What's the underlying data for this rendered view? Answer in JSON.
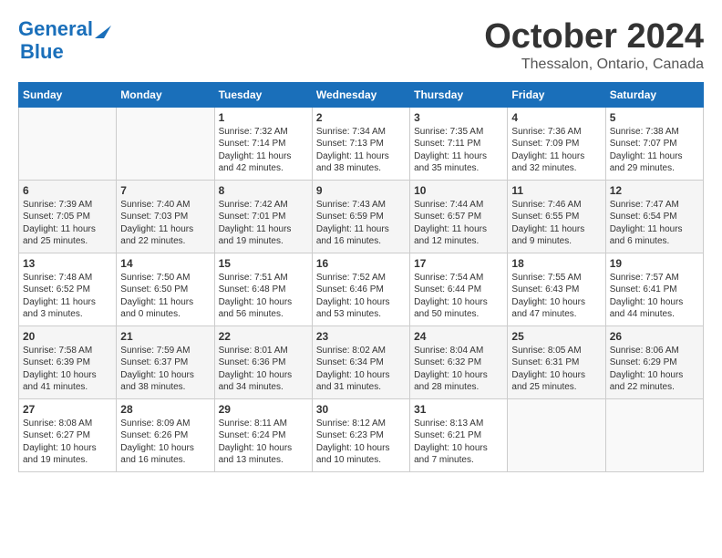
{
  "header": {
    "logo_line1": "General",
    "logo_line2": "Blue",
    "month_title": "October 2024",
    "location": "Thessalon, Ontario, Canada"
  },
  "weekdays": [
    "Sunday",
    "Monday",
    "Tuesday",
    "Wednesday",
    "Thursday",
    "Friday",
    "Saturday"
  ],
  "weeks": [
    [
      {
        "day": "",
        "info": ""
      },
      {
        "day": "",
        "info": ""
      },
      {
        "day": "1",
        "info": "Sunrise: 7:32 AM\nSunset: 7:14 PM\nDaylight: 11 hours and 42 minutes."
      },
      {
        "day": "2",
        "info": "Sunrise: 7:34 AM\nSunset: 7:13 PM\nDaylight: 11 hours and 38 minutes."
      },
      {
        "day": "3",
        "info": "Sunrise: 7:35 AM\nSunset: 7:11 PM\nDaylight: 11 hours and 35 minutes."
      },
      {
        "day": "4",
        "info": "Sunrise: 7:36 AM\nSunset: 7:09 PM\nDaylight: 11 hours and 32 minutes."
      },
      {
        "day": "5",
        "info": "Sunrise: 7:38 AM\nSunset: 7:07 PM\nDaylight: 11 hours and 29 minutes."
      }
    ],
    [
      {
        "day": "6",
        "info": "Sunrise: 7:39 AM\nSunset: 7:05 PM\nDaylight: 11 hours and 25 minutes."
      },
      {
        "day": "7",
        "info": "Sunrise: 7:40 AM\nSunset: 7:03 PM\nDaylight: 11 hours and 22 minutes."
      },
      {
        "day": "8",
        "info": "Sunrise: 7:42 AM\nSunset: 7:01 PM\nDaylight: 11 hours and 19 minutes."
      },
      {
        "day": "9",
        "info": "Sunrise: 7:43 AM\nSunset: 6:59 PM\nDaylight: 11 hours and 16 minutes."
      },
      {
        "day": "10",
        "info": "Sunrise: 7:44 AM\nSunset: 6:57 PM\nDaylight: 11 hours and 12 minutes."
      },
      {
        "day": "11",
        "info": "Sunrise: 7:46 AM\nSunset: 6:55 PM\nDaylight: 11 hours and 9 minutes."
      },
      {
        "day": "12",
        "info": "Sunrise: 7:47 AM\nSunset: 6:54 PM\nDaylight: 11 hours and 6 minutes."
      }
    ],
    [
      {
        "day": "13",
        "info": "Sunrise: 7:48 AM\nSunset: 6:52 PM\nDaylight: 11 hours and 3 minutes."
      },
      {
        "day": "14",
        "info": "Sunrise: 7:50 AM\nSunset: 6:50 PM\nDaylight: 11 hours and 0 minutes."
      },
      {
        "day": "15",
        "info": "Sunrise: 7:51 AM\nSunset: 6:48 PM\nDaylight: 10 hours and 56 minutes."
      },
      {
        "day": "16",
        "info": "Sunrise: 7:52 AM\nSunset: 6:46 PM\nDaylight: 10 hours and 53 minutes."
      },
      {
        "day": "17",
        "info": "Sunrise: 7:54 AM\nSunset: 6:44 PM\nDaylight: 10 hours and 50 minutes."
      },
      {
        "day": "18",
        "info": "Sunrise: 7:55 AM\nSunset: 6:43 PM\nDaylight: 10 hours and 47 minutes."
      },
      {
        "day": "19",
        "info": "Sunrise: 7:57 AM\nSunset: 6:41 PM\nDaylight: 10 hours and 44 minutes."
      }
    ],
    [
      {
        "day": "20",
        "info": "Sunrise: 7:58 AM\nSunset: 6:39 PM\nDaylight: 10 hours and 41 minutes."
      },
      {
        "day": "21",
        "info": "Sunrise: 7:59 AM\nSunset: 6:37 PM\nDaylight: 10 hours and 38 minutes."
      },
      {
        "day": "22",
        "info": "Sunrise: 8:01 AM\nSunset: 6:36 PM\nDaylight: 10 hours and 34 minutes."
      },
      {
        "day": "23",
        "info": "Sunrise: 8:02 AM\nSunset: 6:34 PM\nDaylight: 10 hours and 31 minutes."
      },
      {
        "day": "24",
        "info": "Sunrise: 8:04 AM\nSunset: 6:32 PM\nDaylight: 10 hours and 28 minutes."
      },
      {
        "day": "25",
        "info": "Sunrise: 8:05 AM\nSunset: 6:31 PM\nDaylight: 10 hours and 25 minutes."
      },
      {
        "day": "26",
        "info": "Sunrise: 8:06 AM\nSunset: 6:29 PM\nDaylight: 10 hours and 22 minutes."
      }
    ],
    [
      {
        "day": "27",
        "info": "Sunrise: 8:08 AM\nSunset: 6:27 PM\nDaylight: 10 hours and 19 minutes."
      },
      {
        "day": "28",
        "info": "Sunrise: 8:09 AM\nSunset: 6:26 PM\nDaylight: 10 hours and 16 minutes."
      },
      {
        "day": "29",
        "info": "Sunrise: 8:11 AM\nSunset: 6:24 PM\nDaylight: 10 hours and 13 minutes."
      },
      {
        "day": "30",
        "info": "Sunrise: 8:12 AM\nSunset: 6:23 PM\nDaylight: 10 hours and 10 minutes."
      },
      {
        "day": "31",
        "info": "Sunrise: 8:13 AM\nSunset: 6:21 PM\nDaylight: 10 hours and 7 minutes."
      },
      {
        "day": "",
        "info": ""
      },
      {
        "day": "",
        "info": ""
      }
    ]
  ]
}
